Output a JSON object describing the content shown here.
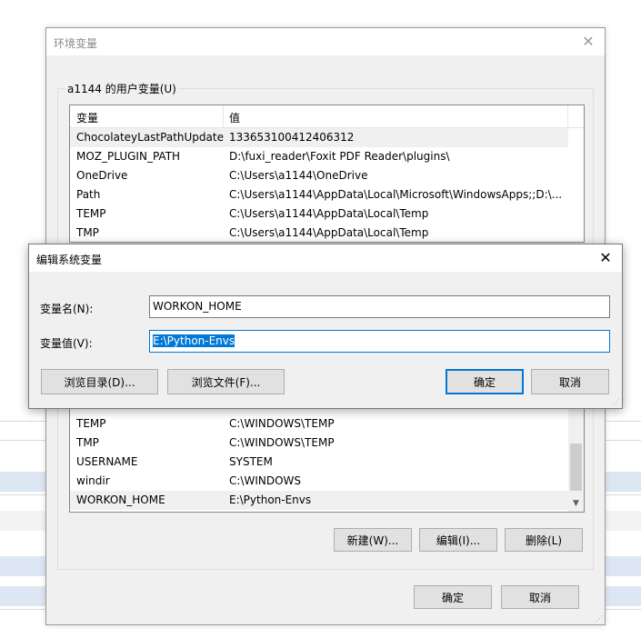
{
  "env_window": {
    "title": "环境变量",
    "user_group_label": "a1144 的用户变量(U)",
    "user_vars": {
      "headers": [
        "变量",
        "值"
      ],
      "rows": [
        {
          "name": "ChocolateyLastPathUpdate",
          "value": "133653100412406312"
        },
        {
          "name": "MOZ_PLUGIN_PATH",
          "value": "D:\\fuxi_reader\\Foxit PDF Reader\\plugins\\"
        },
        {
          "name": "OneDrive",
          "value": "C:\\Users\\a1144\\OneDrive"
        },
        {
          "name": "Path",
          "value": "C:\\Users\\a1144\\AppData\\Local\\Microsoft\\WindowsApps;;D:\\..."
        },
        {
          "name": "TEMP",
          "value": "C:\\Users\\a1144\\AppData\\Local\\Temp"
        },
        {
          "name": "TMP",
          "value": "C:\\Users\\a1144\\AppData\\Local\\Temp"
        }
      ]
    },
    "system_vars": {
      "rows": [
        {
          "name": "TEMP",
          "value": "C:\\WINDOWS\\TEMP"
        },
        {
          "name": "TMP",
          "value": "C:\\WINDOWS\\TEMP"
        },
        {
          "name": "USERNAME",
          "value": "SYSTEM"
        },
        {
          "name": "windir",
          "value": "C:\\WINDOWS"
        },
        {
          "name": "WORKON_HOME",
          "value": "E:\\Python-Envs"
        }
      ]
    },
    "buttons": {
      "new": "新建(W)...",
      "edit": "编辑(I)...",
      "delete": "删除(L)",
      "ok": "确定",
      "cancel": "取消"
    }
  },
  "edit_dialog": {
    "title": "编辑系统变量",
    "name_label": "变量名(N):",
    "name_value": "WORKON_HOME",
    "value_label": "变量值(V):",
    "value_value": "E:\\Python-Envs",
    "buttons": {
      "browse_dir": "浏览目录(D)...",
      "browse_file": "浏览文件(F)...",
      "ok": "确定",
      "cancel": "取消"
    }
  },
  "colors": {
    "accent": "#0078d7",
    "dialog_bg": "#f0f0f0",
    "selection_bg": "#0078d7"
  }
}
